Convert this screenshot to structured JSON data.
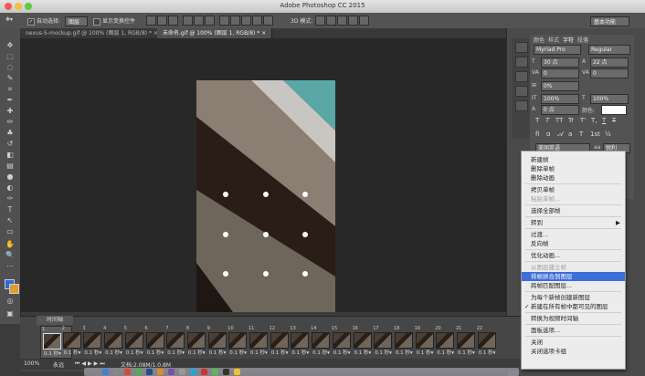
{
  "window": {
    "title": "Adobe Photoshop CC 2015"
  },
  "options_bar": {
    "auto_select_label": "自动选择:",
    "auto_select_value": "图层",
    "show_transform_label": "显示变换控件",
    "mode_3d_label": "3D 模式:",
    "workspace": "基本功能"
  },
  "tabs": [
    {
      "label": "nexus-5-mockup.gif @ 100% (图层 1, RGB/8) *",
      "active": false
    },
    {
      "label": "未命名.gif @ 100% (图层 1, RGB/8) *",
      "active": true
    }
  ],
  "character_panel": {
    "tabs": [
      "颜色",
      "样式",
      "字符",
      "段落"
    ],
    "font_family": "Myriad Pro",
    "font_style": "Regular",
    "font_size": "30 点",
    "leading": "22 点",
    "kerning": "0",
    "tracking": "0",
    "vertical_scale_pct": "0%",
    "horiz_scale": "100%",
    "vert_scale": "100%",
    "baseline": "0 点",
    "color_label": "颜色:",
    "style_buttons": [
      "T",
      "T",
      "TT",
      "Tr",
      "T'",
      "T,",
      "T",
      "T"
    ],
    "language": "美国英语",
    "antialias_badge": "aa",
    "antialias": "锐利"
  },
  "context_menu": {
    "items": [
      {
        "label": "新建帧",
        "disabled": false
      },
      {
        "label": "删除单帧",
        "disabled": false
      },
      {
        "label": "删除动画",
        "disabled": false
      },
      {
        "sep": true
      },
      {
        "label": "拷贝单帧",
        "disabled": false
      },
      {
        "label": "粘贴单帧...",
        "disabled": true
      },
      {
        "sep": true
      },
      {
        "label": "选择全部帧",
        "disabled": false
      },
      {
        "sep": true
      },
      {
        "label": "转到",
        "disabled": false,
        "submenu": true
      },
      {
        "sep": true
      },
      {
        "label": "过渡...",
        "disabled": false
      },
      {
        "label": "反向帧",
        "disabled": false
      },
      {
        "sep": true
      },
      {
        "label": "优化动画...",
        "disabled": false
      },
      {
        "sep": true
      },
      {
        "label": "从图层建立帧",
        "disabled": true
      },
      {
        "label": "将帧拼合到图层",
        "disabled": false,
        "highlighted": true
      },
      {
        "label": "跨帧匹配图层...",
        "disabled": false
      },
      {
        "sep": true
      },
      {
        "label": "为每个新帧创建新图层",
        "disabled": false
      },
      {
        "label": "新建在所有帧中都可见的图层",
        "disabled": false,
        "checked": true
      },
      {
        "sep": true
      },
      {
        "label": "转换为视频时间轴",
        "disabled": false
      },
      {
        "sep": true
      },
      {
        "label": "面板选项...",
        "disabled": false
      },
      {
        "sep": true
      },
      {
        "label": "关闭",
        "disabled": false
      },
      {
        "label": "关闭选项卡组",
        "disabled": false
      }
    ]
  },
  "timeline": {
    "title": "时间轴",
    "frames": [
      {
        "num": "1",
        "delay": "0.1 秒▾"
      },
      {
        "num": "2",
        "delay": "0.1 秒▾"
      },
      {
        "num": "3",
        "delay": "0.1 秒▾"
      },
      {
        "num": "4",
        "delay": "0.1 秒▾"
      },
      {
        "num": "5",
        "delay": "0.1 秒▾"
      },
      {
        "num": "6",
        "delay": "0.1 秒▾"
      },
      {
        "num": "7",
        "delay": "0.1 秒▾"
      },
      {
        "num": "8",
        "delay": "0.1 秒▾"
      },
      {
        "num": "9",
        "delay": "0.1 秒▾"
      },
      {
        "num": "10",
        "delay": "0.1 秒▾"
      },
      {
        "num": "11",
        "delay": "0.1 秒▾"
      },
      {
        "num": "12",
        "delay": "0.1 秒▾"
      },
      {
        "num": "13",
        "delay": "0.1 秒▾"
      },
      {
        "num": "14",
        "delay": "0.1 秒▾"
      },
      {
        "num": "15",
        "delay": "0.1 秒▾"
      },
      {
        "num": "16",
        "delay": "0.1 秒▾"
      },
      {
        "num": "17",
        "delay": "0.1 秒▾"
      },
      {
        "num": "18",
        "delay": "0.1 秒▾"
      },
      {
        "num": "19",
        "delay": "0.1 秒▾"
      },
      {
        "num": "20",
        "delay": "0.1 秒▾"
      },
      {
        "num": "21",
        "delay": "0.1 秒▾"
      },
      {
        "num": "22",
        "delay": "0.1 秒▾"
      }
    ],
    "loop": "永远",
    "zoom": "100%",
    "doc_info": "文档:2.08M/1.0.8M"
  },
  "colors": {
    "accent_highlight": "#3d6ed9",
    "teal": "#5aa7a8"
  }
}
